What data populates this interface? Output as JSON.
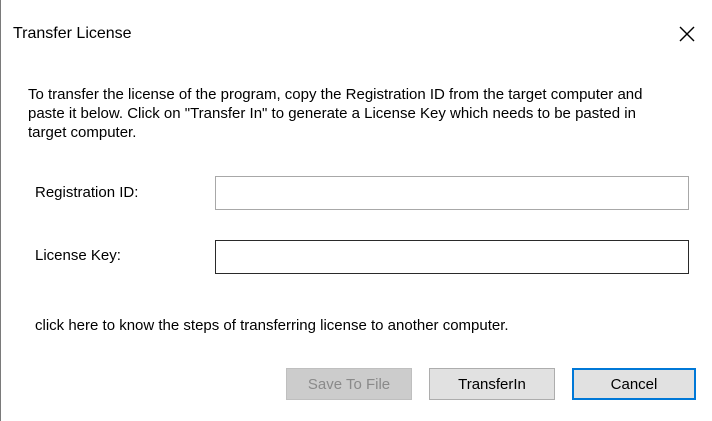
{
  "window": {
    "title": "Transfer License",
    "close_icon": "close-icon"
  },
  "colors": {
    "accent": "#0078d7",
    "button_face": "#e1e1e1",
    "button_disabled_face": "#cccccc",
    "button_disabled_text": "#8a8a8a"
  },
  "main": {
    "instructions": "To transfer the license of the program, copy the Registration ID from the target computer and paste it below. Click on \"Transfer In\" to generate a License Key which needs to be pasted in target computer.",
    "registration_id": {
      "label": "Registration ID:",
      "value": "",
      "placeholder": ""
    },
    "license_key": {
      "label": "License Key:",
      "value": "",
      "placeholder": ""
    },
    "help_link": "click here to know the steps of transferring license to another computer."
  },
  "buttons": {
    "save_to_file": "Save To File",
    "save_to_file_enabled": false,
    "transfer_in": "TransferIn",
    "cancel": "Cancel"
  }
}
